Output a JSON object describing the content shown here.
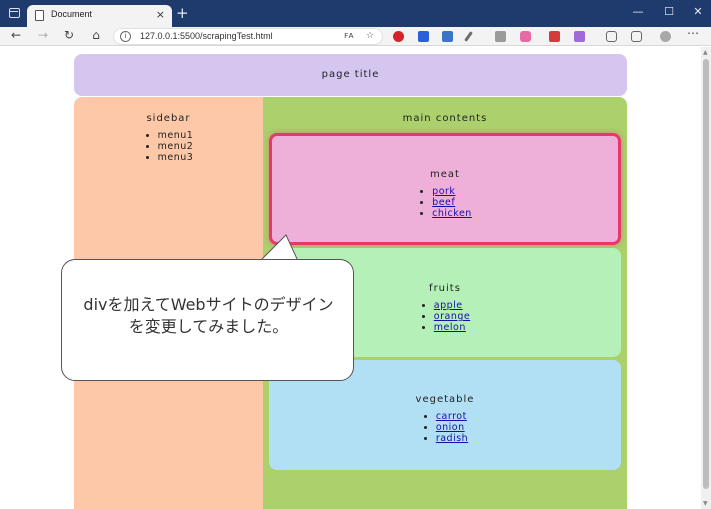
{
  "browser": {
    "tab_title": "Document",
    "tab_close": "×",
    "new_tab": "+",
    "window_controls": {
      "minimize": "—",
      "maximize": "☐",
      "close": "✕"
    },
    "nav": {
      "back": "←",
      "forward": "→",
      "reload": "↻",
      "home": "⌂"
    },
    "url": "127.0.0.1:5500/scrapingTest.html",
    "url_info_glyph": "i"
  },
  "page": {
    "title": "page title",
    "sidebar": {
      "heading": "sidebar",
      "items": [
        "menu1",
        "menu2",
        "menu3"
      ]
    },
    "main": {
      "heading": "main contents",
      "sections": [
        {
          "title": "meat",
          "links": [
            "pork",
            "beef",
            "chicken"
          ]
        },
        {
          "title": "fruits",
          "links": [
            "apple",
            "orange",
            "melon"
          ]
        },
        {
          "title": "vegetable",
          "links": [
            "carrot",
            "onion",
            "radish"
          ]
        }
      ]
    }
  },
  "callout": {
    "line1": "divを加えてWebサイトのデザイン",
    "line2": "を変更してみました。"
  },
  "colors": {
    "titlebar": "#1f3b6e",
    "page_title_bg": "#d5c6f0",
    "sidebar_bg": "#fdc8a7",
    "main_bg": "#abd06c",
    "meat_bg": "#eeb0d8",
    "meat_highlight": "#e8376d",
    "fruits_bg": "#b4f0b8",
    "vegetable_bg": "#b1e0f4"
  },
  "icons": [
    "window-icon",
    "page-icon",
    "back-icon",
    "forward-icon",
    "reload-icon",
    "home-icon",
    "info-icon",
    "read-aloud-icon",
    "favorite-icon",
    "pinterest-icon",
    "extension-icon",
    "pen-icon",
    "camera-icon",
    "collections-icon",
    "profile-icon",
    "more-icon"
  ]
}
